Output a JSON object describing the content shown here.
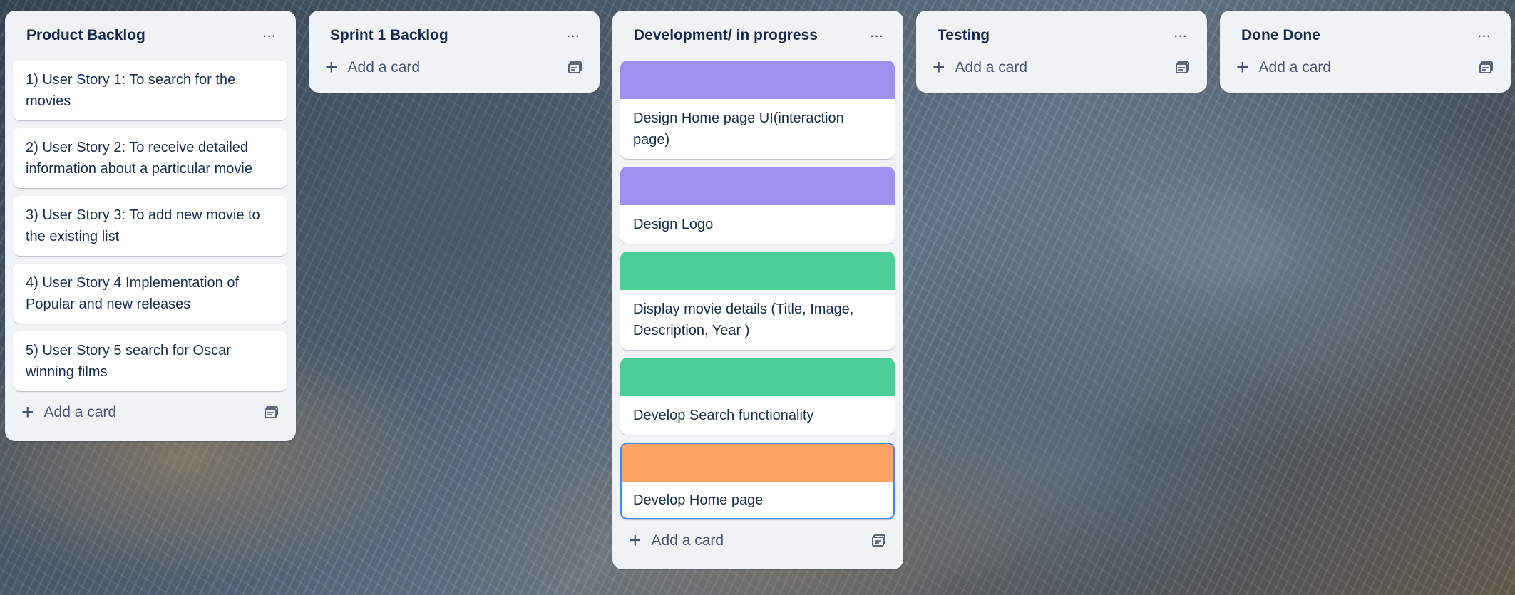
{
  "board": {
    "lists": [
      {
        "title": "Product Backlog",
        "add_card_label": "Add a card",
        "cards": [
          {
            "text": "1) User Story 1: To search for the movies"
          },
          {
            "text": "2) User Story 2: To receive detailed information about a particular movie"
          },
          {
            "text": "3) User Story 3: To add new movie to the existing list"
          },
          {
            "text": "4) User Story 4 Implementation of Popular and new releases"
          },
          {
            "text": "5) User Story 5 search for Oscar winning films"
          }
        ]
      },
      {
        "title": "Sprint 1 Backlog",
        "add_card_label": "Add a card",
        "cards": []
      },
      {
        "title": "Development/ in progress",
        "add_card_label": "Add a card",
        "cards": [
          {
            "text": "Design Home page UI(interaction page)",
            "cover": "#9f8fef"
          },
          {
            "text": "Design Logo",
            "cover": "#9f8fef"
          },
          {
            "text": "Display movie details (Title, Image, Description, Year )",
            "cover": "#4bce97"
          },
          {
            "text": "Develop Search functionality",
            "cover": "#4bce97"
          },
          {
            "text": "Develop Home page",
            "cover": "#fea362",
            "selected": true
          }
        ]
      },
      {
        "title": "Testing",
        "add_card_label": "Add a card",
        "cards": []
      },
      {
        "title": "Done Done",
        "add_card_label": "Add a card",
        "cards": []
      }
    ]
  },
  "icons": {
    "menu": "ellipsis-icon",
    "add": "plus-icon",
    "template": "card-template-icon"
  },
  "colors": {
    "list_bg": "#f1f2f4",
    "text": "#172b4d",
    "selected_border": "#388bff"
  }
}
